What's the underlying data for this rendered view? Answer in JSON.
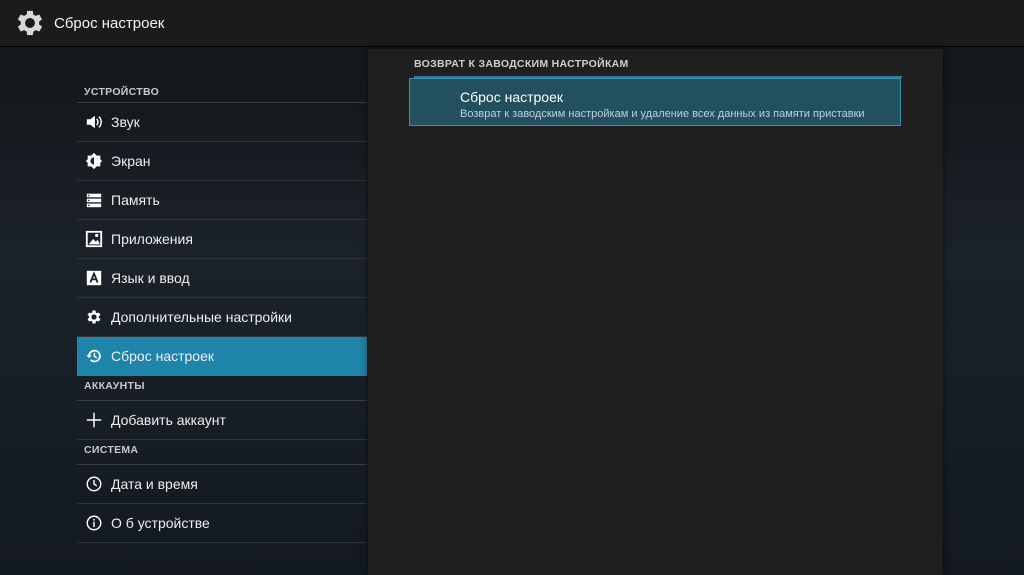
{
  "actionbar": {
    "title": "Сброс настроек",
    "icon": "gear-icon"
  },
  "sidebar": {
    "sections": [
      {
        "header": "Устройство",
        "items": [
          {
            "label": "Звук",
            "icon": "speaker-icon"
          },
          {
            "label": "Экран",
            "icon": "brightness-icon"
          },
          {
            "label": "Память",
            "icon": "storage-icon"
          },
          {
            "label": "Приложения",
            "icon": "apps-icon"
          },
          {
            "label": "Язык и ввод",
            "icon": "keyboard-a-icon"
          },
          {
            "label": "Дополнительные настройки",
            "icon": "gear-icon"
          },
          {
            "label": "Сброс настроек",
            "icon": "restore-icon",
            "selected": true
          }
        ]
      },
      {
        "header": "Аккаунты",
        "items": [
          {
            "label": "Добавить аккаунт",
            "icon": "plus-icon"
          }
        ]
      },
      {
        "header": "Система",
        "items": [
          {
            "label": "Дата и время",
            "icon": "clock-icon"
          },
          {
            "label": "О б устройстве",
            "icon": "info-icon"
          }
        ]
      }
    ]
  },
  "detail": {
    "header": "Возврат к заводским настройкам",
    "item_title": "Сброс настроек",
    "item_summary": "Возврат к заводским настройкам и удаление всех данных из памяти приставки"
  },
  "colors": {
    "accent": "#1e84a9",
    "panel": "#1f1f1f",
    "actionbar": "#1b1b1b"
  }
}
